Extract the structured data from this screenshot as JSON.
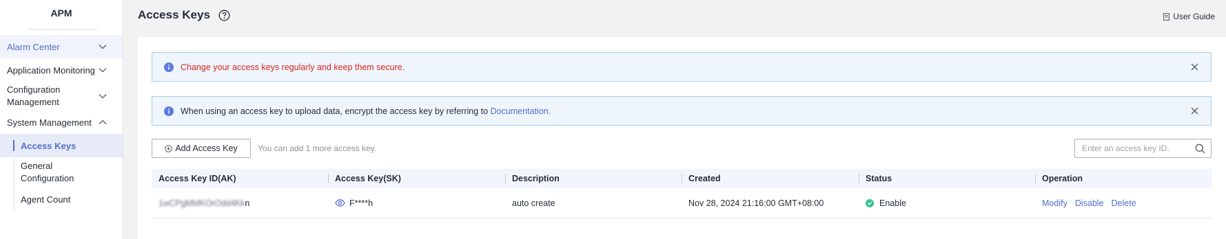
{
  "sidebar": {
    "app_title": "APM",
    "items": [
      {
        "label": "Alarm Center",
        "icon": "chevron-down-icon"
      },
      {
        "label": "Application Monitoring",
        "icon": "chevron-down-icon"
      },
      {
        "label": "Configuration Management",
        "icon": "chevron-down-icon"
      },
      {
        "label": "System Management",
        "icon": "chevron-up-icon"
      }
    ],
    "sub_items": [
      {
        "label": "Access Keys",
        "active": true
      },
      {
        "label": "General Configuration"
      },
      {
        "label": "Agent Count"
      }
    ]
  },
  "header": {
    "title": "Access Keys",
    "user_guide": "User Guide"
  },
  "alerts": [
    {
      "text": "Change your access keys regularly and keep them secure."
    },
    {
      "text": "When using an access key to upload data, encrypt the access key by referring to ",
      "link": "Documentation",
      "suffix": "."
    }
  ],
  "toolbar": {
    "add_button": "Add Access Key",
    "hint": "You can add 1 more access key.",
    "search_placeholder": "Enter an access key ID."
  },
  "table": {
    "columns": [
      "Access Key ID(AK)",
      "Access Key(SK)",
      "Description",
      "Created",
      "Status",
      "Operation"
    ],
    "rows": [
      {
        "ak_masked": "1wCPgMMKOrOdd4Kk",
        "ak_tail": "n",
        "sk": "F****h",
        "description": "auto create",
        "created": "Nov 28, 2024 21:16:00 GMT+08:00",
        "status": "Enable",
        "operations": [
          "Modify",
          "Disable",
          "Delete"
        ]
      }
    ]
  },
  "colors": {
    "accent": "#526ecc",
    "warning_text": "#e02020",
    "status_enabled": "#3ac295",
    "alert_bg": "#eef6fc"
  }
}
